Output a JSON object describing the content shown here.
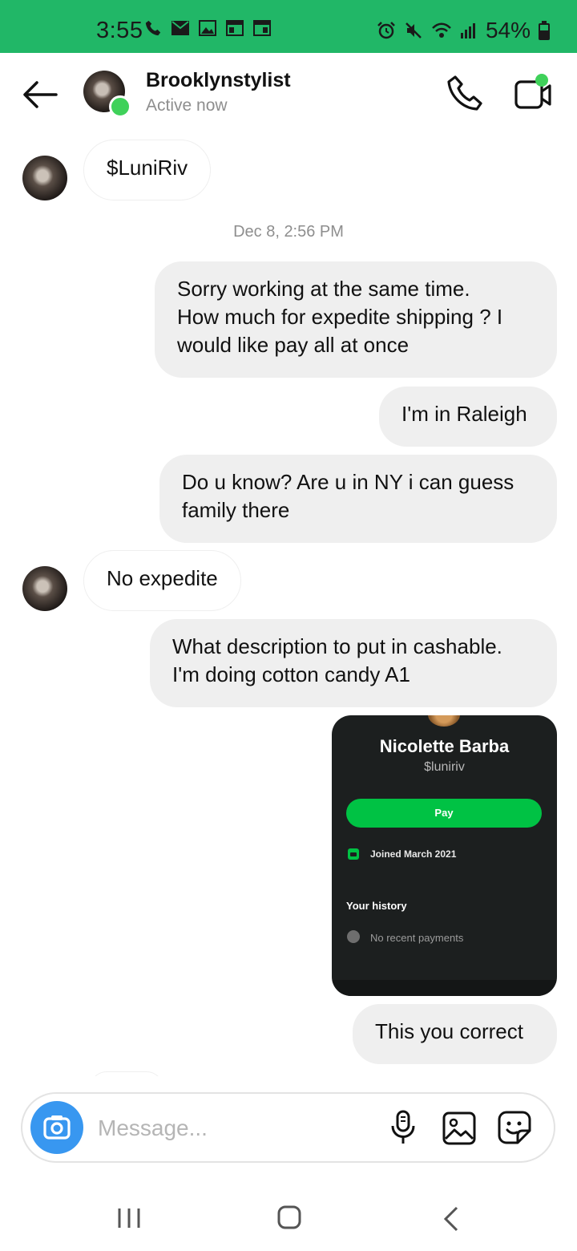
{
  "status_bar": {
    "time": "3:55",
    "battery": "54%",
    "left_icons": [
      "phone-icon",
      "mail-icon",
      "image-icon",
      "calendar-icon",
      "calendar-icon"
    ],
    "right_icons": [
      "alarm-icon",
      "mute-icon",
      "wifi-icon",
      "signal-icon",
      "battery-icon"
    ],
    "background": "#21b767"
  },
  "header": {
    "name": "Brooklynstylist",
    "status": "Active now",
    "online_color": "#3fd15a"
  },
  "messages": [
    {
      "side": "in",
      "text": "$LuniRiv"
    },
    {
      "timestamp": "Dec 8, 2:56 PM"
    },
    {
      "side": "out",
      "lines": [
        "Sorry working at the same time.",
        "How much for expedite shipping ? I",
        "would like pay all at once"
      ]
    },
    {
      "side": "out",
      "text": "I'm in Raleigh"
    },
    {
      "side": "out",
      "lines": [
        "Do u know? Are u in NY i can guess",
        "family there"
      ]
    },
    {
      "side": "in",
      "text": "No expedite"
    },
    {
      "side": "out",
      "lines": [
        "What description to put in cashable.",
        "I'm doing cotton candy A1"
      ]
    },
    {
      "side": "out",
      "text": "This you correct"
    }
  ],
  "shared_card": {
    "name": "Nicolette Barba",
    "handle": "$luniriv",
    "pay_label": "Pay",
    "joined": "Joined March 2021",
    "history_title": "Your history",
    "history_empty": "No recent payments",
    "pay_color": "#00c244"
  },
  "composer": {
    "placeholder": "Message...",
    "value": "",
    "camera_color": "#3897f0"
  }
}
